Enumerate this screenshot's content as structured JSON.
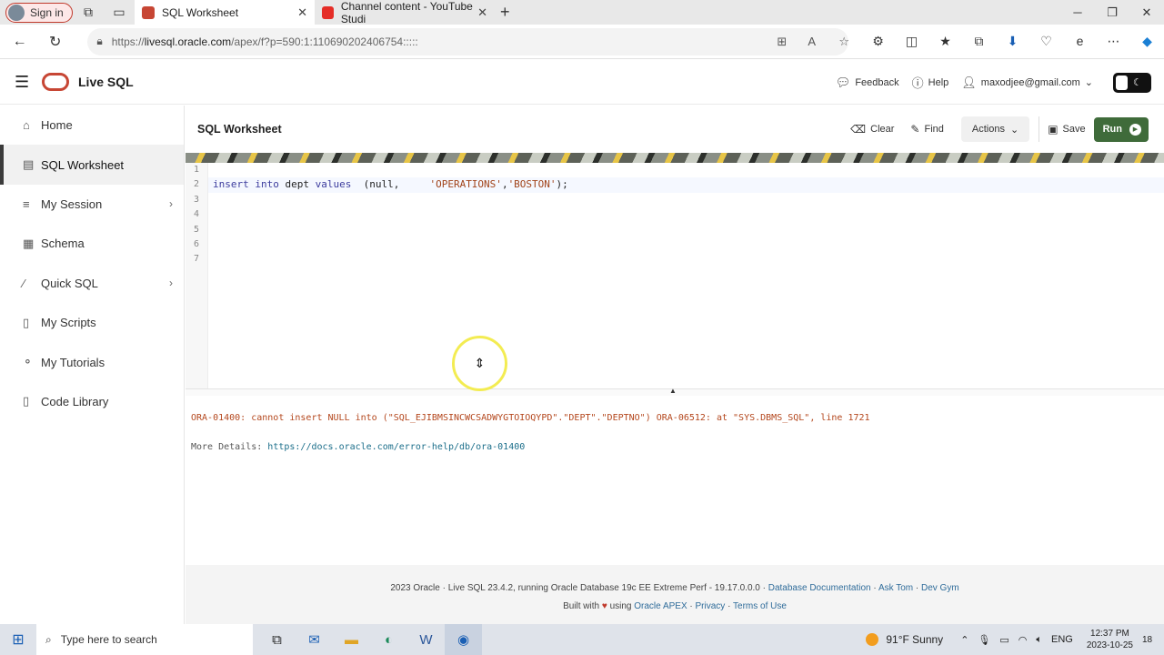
{
  "browser": {
    "signin_label": "Sign in",
    "tabs": [
      {
        "title": "SQL Worksheet",
        "active": true
      },
      {
        "title": "Channel content - YouTube Studi",
        "active": false
      }
    ],
    "url_prefix": "https://",
    "url_host": "livesql.oracle.com",
    "url_path": "/apex/f?p=590:1:110690202406754:::::"
  },
  "app": {
    "title": "Live SQL",
    "header": {
      "feedback": "Feedback",
      "help": "Help",
      "user": "maxodjee@gmail.com"
    }
  },
  "sidebar": {
    "items": [
      {
        "label": "Home",
        "icon": "home-icon"
      },
      {
        "label": "SQL Worksheet",
        "icon": "worksheet-icon",
        "active": true
      },
      {
        "label": "My Session",
        "icon": "session-icon",
        "chevron": true
      },
      {
        "label": "Schema",
        "icon": "schema-icon"
      },
      {
        "label": "Quick SQL",
        "icon": "wand-icon",
        "chevron": true
      },
      {
        "label": "My Scripts",
        "icon": "scripts-icon"
      },
      {
        "label": "My Tutorials",
        "icon": "tutorials-icon"
      },
      {
        "label": "Code Library",
        "icon": "library-icon"
      }
    ]
  },
  "worksheet": {
    "title": "SQL Worksheet",
    "clear": "Clear",
    "find": "Find",
    "actions": "Actions",
    "save": "Save",
    "run": "Run",
    "line_numbers": [
      "1",
      "2",
      "3",
      "4",
      "5",
      "6",
      "7"
    ],
    "code": {
      "line2_kw1": "insert into",
      "line2_t1": " dept ",
      "line2_kw2": "values",
      "line2_t2": "  (null,     ",
      "line2_s1": "'OPERATIONS'",
      "line2_t3": ",",
      "line2_s2": "'BOSTON'",
      "line2_t4": ");"
    }
  },
  "output": {
    "error": "ORA-01400: cannot insert NULL into (\"SQL_EJIBMSINCWCSADWYGTOIOQYPD\".\"DEPT\".\"DEPTNO\") ORA-06512: at \"SYS.DBMS_SQL\", line 1721",
    "more_label": "More Details: ",
    "more_link": "https://docs.oracle.com/error-help/db/ora-01400"
  },
  "footer": {
    "line1_text": "2023 Oracle · Live SQL 23.4.2, running Oracle Database 19c EE Extreme Perf - 19.17.0.0.0 · ",
    "doc_link": "Database Documentation",
    "ask_tom": "Ask Tom",
    "dev_gym": "Dev Gym",
    "built_with": "Built with",
    "using": "using",
    "apex_link": "Oracle APEX",
    "privacy": "Privacy",
    "terms": "Terms of Use"
  },
  "taskbar": {
    "search_placeholder": "Type here to search",
    "weather": "91°F  Sunny",
    "lang": "ENG",
    "time": "12:37 PM",
    "date": "2023-10-25",
    "notifications": "18"
  }
}
